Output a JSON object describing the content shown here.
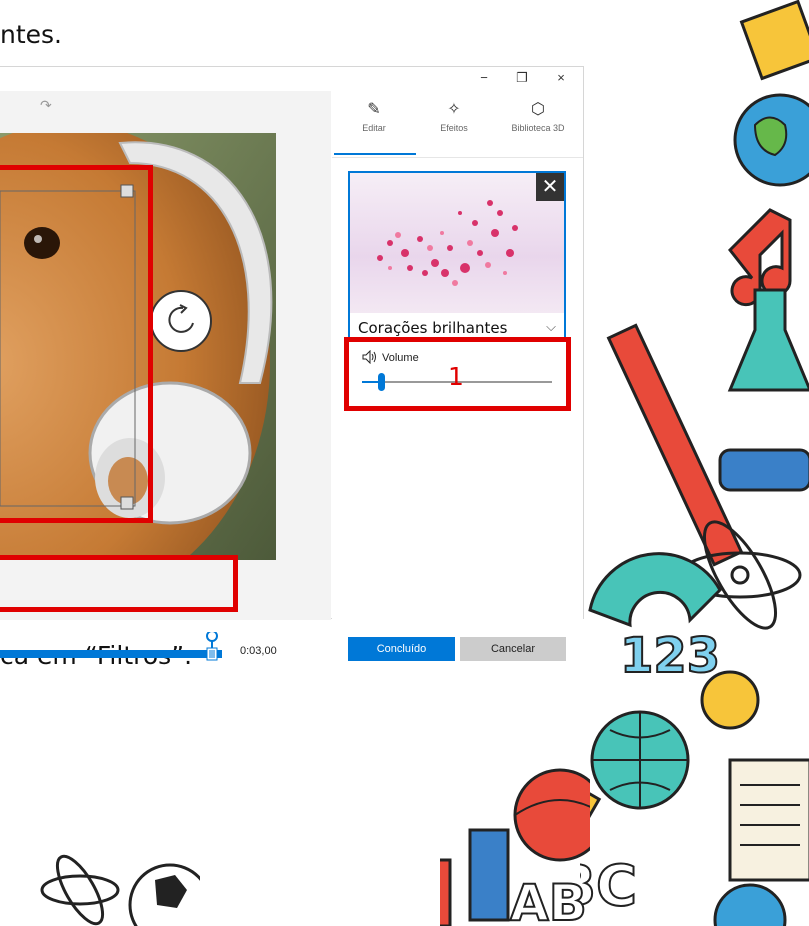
{
  "slide": {
    "top_text": "ntes.",
    "bottom_text": "ca em “Filtros”."
  },
  "window": {
    "minimize": "−",
    "restore": "❐",
    "close": "×",
    "redo_icon": "↷"
  },
  "tabs": [
    {
      "label": "Editar",
      "icon": "pencil-icon",
      "glyph": "✎"
    },
    {
      "label": "Efeitos",
      "icon": "sparkle-icon",
      "glyph": "✧"
    },
    {
      "label": "Biblioteca 3D",
      "icon": "cube-icon",
      "glyph": "⬡"
    }
  ],
  "effect": {
    "name": "Corações brilhantes",
    "close": "✕",
    "chevron": "⌵"
  },
  "volume": {
    "label": "Volume",
    "icon": "speaker-icon",
    "glyph": "🔈",
    "level": 0.1
  },
  "buttons": {
    "done": "Concluído",
    "cancel": "Cancelar"
  },
  "timeline": {
    "time": "0:03,00",
    "progress": 1.0
  },
  "annotations": {
    "number": "1"
  },
  "colors": {
    "accent": "#0078d7",
    "annotation": "#e00000"
  }
}
